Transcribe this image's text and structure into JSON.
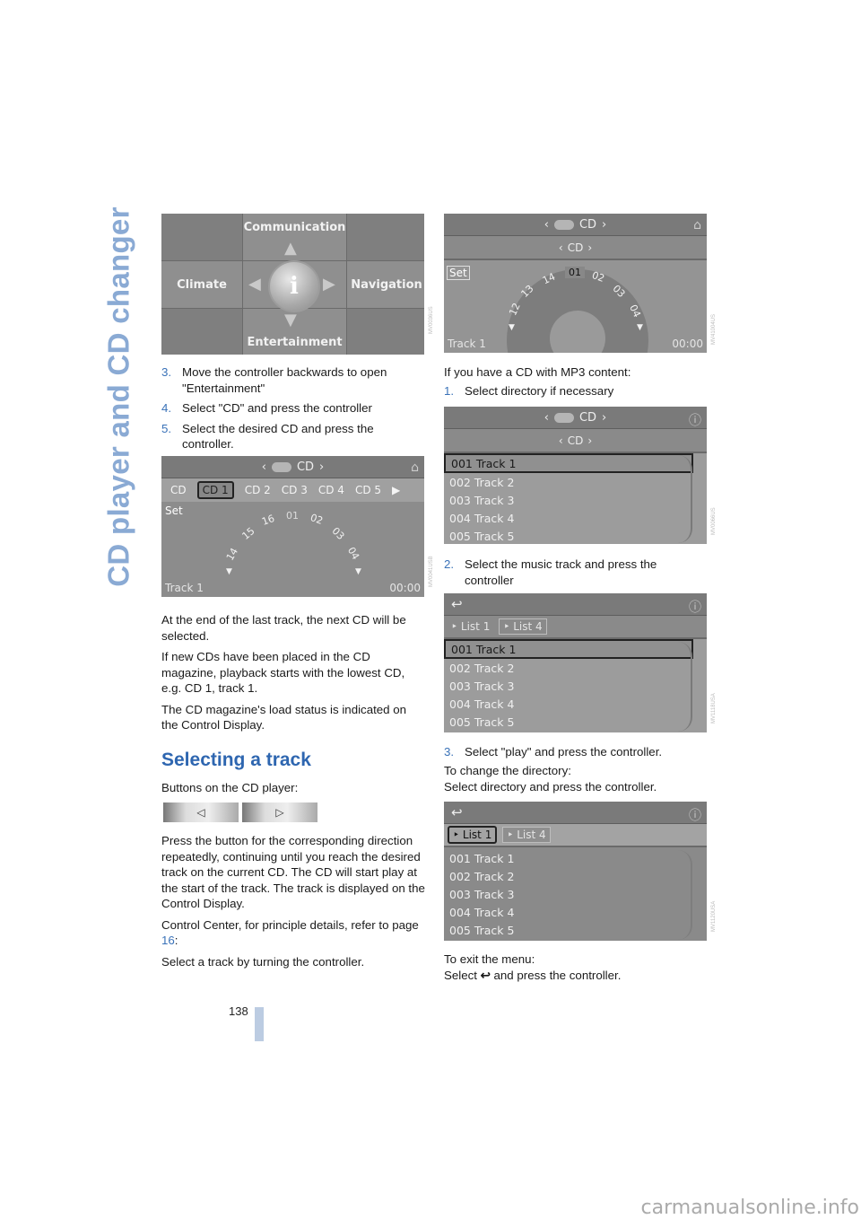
{
  "chapter_title": "CD player and CD changer",
  "page_number": "138",
  "left": {
    "main_menu": {
      "items": [
        "Communication",
        "Climate",
        "Navigation",
        "Entertainment"
      ],
      "center_icon": "i",
      "code": "MV0036US"
    },
    "steps1": [
      {
        "num": "3.",
        "text": "Move the controller backwards to open \"Entertainment\""
      },
      {
        "num": "4.",
        "text": "Select \"CD\" and press the controller"
      },
      {
        "num": "5.",
        "text": "Select the desired CD and press the controller."
      }
    ],
    "cd_screen": {
      "title": "CD",
      "tabs": [
        "CD",
        "CD 1",
        "CD 2",
        "CD 3",
        "CD 4",
        "CD 5"
      ],
      "selected_tab": "CD 1",
      "set_label": "Set",
      "tracks": [
        "14",
        "15",
        "16",
        "01",
        "02",
        "03",
        "04"
      ],
      "status_left": "Track 1",
      "status_right": "00:00",
      "code": "MV0041USB"
    },
    "paragraphs": [
      "At the end of the last track, the next CD will be selected.",
      "If new CDs have been placed in the CD magazine, playback starts with the lowest CD, e.g. CD 1, track 1.",
      "The CD magazine's load status is indicated on the Control Display."
    ],
    "section_heading": "Selecting a track",
    "buttons_intro": "Buttons on the CD player:",
    "button_prev": "◁",
    "button_next": "▷",
    "paragraphs2": [
      "Press the button for the corresponding direction repeatedly, continuing until you reach the desired track on the current CD. The CD will start play at the start of the track. The track is displayed on the Control Display."
    ],
    "ref_text_before": "Control Center, for principle details, refer to page ",
    "ref_page": "16",
    "ref_text_after": ":",
    "last_line": "Select a track by turning the controller."
  },
  "right": {
    "cd_screen2": {
      "title": "CD",
      "subtitle": "CD",
      "set_label": "Set",
      "tracks": [
        "12",
        "13",
        "14",
        "01",
        "02",
        "03",
        "04"
      ],
      "selected_track": "01",
      "status_left": "Track 1",
      "status_right": "00:00",
      "code": "MV41004US"
    },
    "mp3_intro": "If you have a CD with MP3 content:",
    "step1": {
      "num": "1.",
      "text": "Select directory if necessary"
    },
    "list_screen1": {
      "title": "CD",
      "subtitle": "CD",
      "rows": [
        "001 Track  1",
        "002 Track  2",
        "003 Track  3",
        "004 Track  4",
        "005 Track  5"
      ],
      "selected_row": 0,
      "code": "MV0066US"
    },
    "step2": {
      "num": "2.",
      "text": "Select the music track and press the controller"
    },
    "list_screen2": {
      "chips": [
        "List 1",
        "List 4"
      ],
      "active_chip": 1,
      "rows": [
        "001 Track  1",
        "002 Track  2",
        "003 Track  3",
        "004 Track  4",
        "005 Track  5"
      ],
      "selected_row": 0,
      "code": "MV1118USA"
    },
    "step3": {
      "num": "3.",
      "text": "Select \"play\" and press the controller."
    },
    "dir_change_1": "To change the directory:",
    "dir_change_2": "Select directory and press the controller.",
    "list_screen3": {
      "chips": [
        "List 1",
        "List 4"
      ],
      "active_chip": 0,
      "rows": [
        "001 Track  1",
        "002 Track  2",
        "003 Track  3",
        "004 Track  4",
        "005 Track  5"
      ],
      "code": "MV1120USA"
    },
    "exit_1": "To exit the menu:",
    "exit_2a": "Select ",
    "exit_2b": " and press the controller."
  },
  "watermark": "carmanualsonline.info"
}
